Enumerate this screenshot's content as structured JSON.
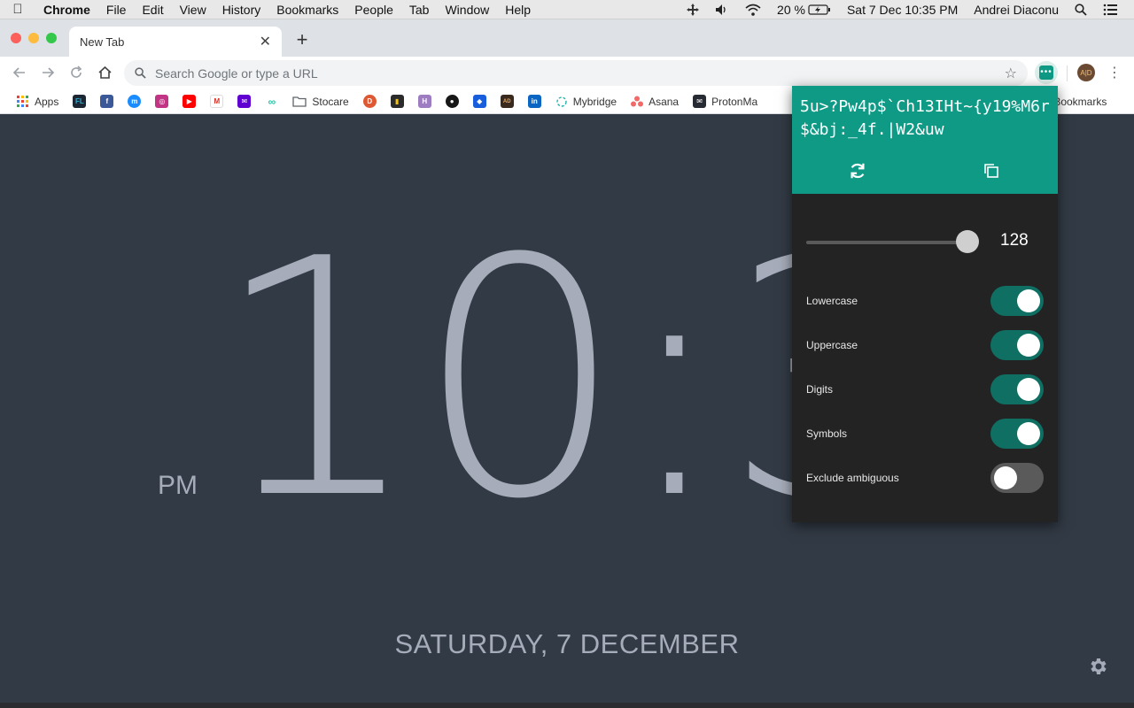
{
  "menubar": {
    "app": "Chrome",
    "items": [
      "File",
      "Edit",
      "View",
      "History",
      "Bookmarks",
      "People",
      "Tab",
      "Window",
      "Help"
    ],
    "battery": "20 %",
    "datetime": "Sat 7 Dec  10:35 PM",
    "user": "Andrei Diaconu"
  },
  "tabs": [
    {
      "title": "New Tab"
    }
  ],
  "omnibox": {
    "placeholder": "Search Google or type a URL"
  },
  "avatar_initials": "A|D",
  "bookmarks": {
    "items": [
      {
        "label": "Apps",
        "icon": "apps-grid-icon"
      },
      {
        "label": "",
        "icon": "fl-icon",
        "badge": "FL"
      },
      {
        "label": "",
        "icon": "facebook-icon",
        "badge": "f"
      },
      {
        "label": "",
        "icon": "messenger-icon",
        "badge": "m"
      },
      {
        "label": "",
        "icon": "instagram-icon",
        "badge": "◎"
      },
      {
        "label": "",
        "icon": "youtube-icon",
        "badge": "▶"
      },
      {
        "label": "",
        "icon": "gmail-icon",
        "badge": "M"
      },
      {
        "label": "",
        "icon": "yahoo-mail-icon",
        "badge": "✉"
      },
      {
        "label": "",
        "icon": "link-icon",
        "badge": "∞"
      },
      {
        "label": "Stocare",
        "icon": "folder-icon"
      },
      {
        "label": "",
        "icon": "duckduckgo-icon",
        "badge": "D"
      },
      {
        "label": "",
        "icon": "keep-icon",
        "badge": "▮"
      },
      {
        "label": "",
        "icon": "heroku-icon",
        "badge": "H"
      },
      {
        "label": "",
        "icon": "github-icon",
        "badge": "●"
      },
      {
        "label": "",
        "icon": "bitwarden-icon",
        "badge": "◆"
      },
      {
        "label": "",
        "icon": "ad-icon",
        "badge": "AD"
      },
      {
        "label": "",
        "icon": "linkedin-icon",
        "badge": "in"
      },
      {
        "label": "Mybridge",
        "icon": "mybridge-icon"
      },
      {
        "label": "Asana",
        "icon": "asana-icon"
      },
      {
        "label": "ProtonMa",
        "icon": "protonmail-icon"
      }
    ],
    "other": "r Bookmarks"
  },
  "clock": {
    "ampm": "PM",
    "time": "10:3",
    "date": "SATURDAY, 7 DECEMBER"
  },
  "generator": {
    "password": "5u>?Pw4p$`Ch13IHt~{y19%M6r$&bj:_4f.|W2&uw",
    "length": "128",
    "length_fraction": 1.0,
    "options": [
      {
        "label": "Lowercase",
        "on": true
      },
      {
        "label": "Uppercase",
        "on": true
      },
      {
        "label": "Digits",
        "on": true
      },
      {
        "label": "Symbols",
        "on": true
      },
      {
        "label": "Exclude ambiguous",
        "on": false
      }
    ]
  },
  "colors": {
    "accent": "#0f9a86",
    "toggle_on": "#0e6f62",
    "background": "#323a45",
    "clock_text": "#a6acba",
    "popup_bg": "#232323"
  }
}
